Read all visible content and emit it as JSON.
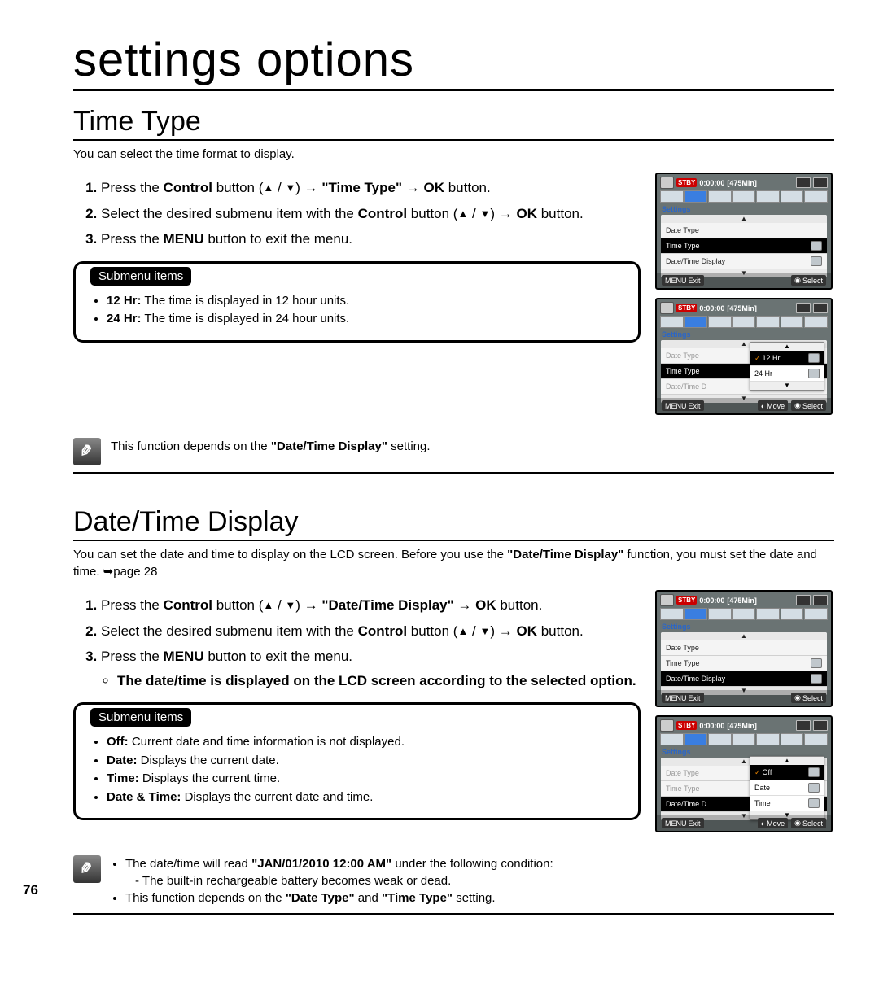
{
  "page_number": "76",
  "page_title": "settings options",
  "section1": {
    "title": "Time Type",
    "intro": "You can select the time format to display.",
    "step1_pre": "Press the ",
    "step1_control": "Control",
    "step1_between": " button (",
    "step1_arrow": " → ",
    "step1_target": "\"Time Type\"",
    "step1_ok": "OK",
    "step1_end": " button.",
    "step2_pre": "Select the desired submenu item with the ",
    "step2_control": "Control",
    "step2_between": " button (",
    "step2_arrow": " → ",
    "step2_ok": "OK",
    "step2_end": " button.",
    "step3_pre": "Press the ",
    "step3_menu": "MENU",
    "step3_end": " button to exit the menu.",
    "submenu_label": "Submenu items",
    "sm1_t": "12 Hr:",
    "sm1_d": " The time is displayed in 12 hour units.",
    "sm2_t": "24 Hr:",
    "sm2_d": " The time is displayed in 24 hour units.",
    "note_pre": "This function depends on the ",
    "note_bold": "\"Date/Time Display\"",
    "note_end": " setting."
  },
  "section2": {
    "title": "Date/Time Display",
    "intro_pre": "You can set the date and time to display on the LCD screen. Before you use the ",
    "intro_bold": "\"Date/Time Display\"",
    "intro_end": " function, you must set the date and time. ➥page 28",
    "step1_pre": "Press the ",
    "step1_control": "Control",
    "step1_between": " button (",
    "step1_arrow": " → ",
    "step1_target": "\"Date/Time Display\"",
    "step1_ok": "OK",
    "step1_end": " button.",
    "step2_pre": "Select the desired submenu item with the ",
    "step2_control": "Control",
    "step2_between": " button (",
    "step2_arrow": " → ",
    "step2_ok": "OK",
    "step2_end": " button.",
    "step3_pre": "Press the ",
    "step3_menu": "MENU",
    "step3_end": " button to exit the menu.",
    "step3_bullet": "The date/time is displayed on the LCD screen according to the selected option.",
    "submenu_label": "Submenu items",
    "sm1_t": "Off:",
    "sm1_d": " Current date and time information is not displayed.",
    "sm2_t": "Date:",
    "sm2_d": " Displays the current date.",
    "sm3_t": "Time:",
    "sm3_d": " Displays the current time.",
    "sm4_t": "Date & Time:",
    "sm4_d": " Displays the current date and time.",
    "note1_pre": "The date/time will read ",
    "note1_bold": "\"JAN/01/2010 12:00 AM\"",
    "note1_end": " under the following condition:",
    "note1_sub": "The built-in rechargeable battery becomes weak or dead.",
    "note2_pre": "This function depends on the ",
    "note2_b1": "\"Date Type\"",
    "note2_mid": " and ",
    "note2_b2": "\"Time Type\"",
    "note2_end": " setting."
  },
  "cam": {
    "stby": "STBY",
    "timecode": "0:00:00",
    "remain": "[475Min]",
    "settings": "Settings",
    "date_type": "Date Type",
    "time_type": "Time Type",
    "datetime_display": "Date/Time Display",
    "datetime_d": "Date/Time D",
    "exit": "Exit",
    "select": "Select",
    "move": "Move",
    "opt_12": "12 Hr",
    "opt_24": "24 Hr",
    "opt_off": "Off",
    "opt_date": "Date",
    "opt_time": "Time",
    "menu_btn": "MENU"
  }
}
